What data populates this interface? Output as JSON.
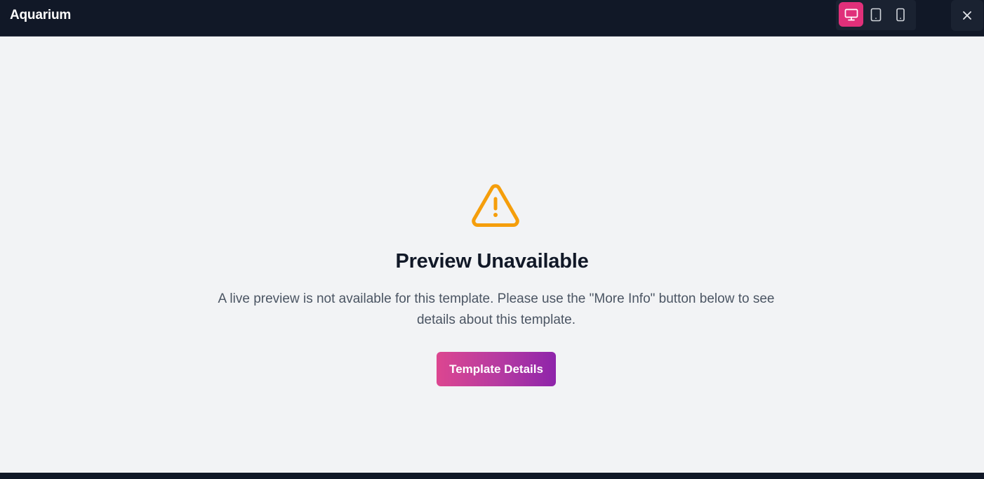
{
  "header": {
    "title": "Aquarium",
    "devices": [
      {
        "icon": "desktop-icon",
        "active": true
      },
      {
        "icon": "tablet-icon",
        "active": false
      },
      {
        "icon": "mobile-icon",
        "active": false
      }
    ],
    "close_icon": "close-icon"
  },
  "main": {
    "icon": "warning-icon",
    "heading": "Preview Unavailable",
    "message_line1": "A live preview is not available for this template. Please use the \"More Info\" button below to see",
    "message_line2": "details about this template.",
    "button_label": "Template Details"
  },
  "colors": {
    "topbar": "#111827",
    "accent": "#e0307a",
    "warning": "#f59e0b",
    "button_gradient_start": "#dc4690",
    "button_gradient_end": "#8e24aa",
    "background": "#f2f3f5"
  }
}
